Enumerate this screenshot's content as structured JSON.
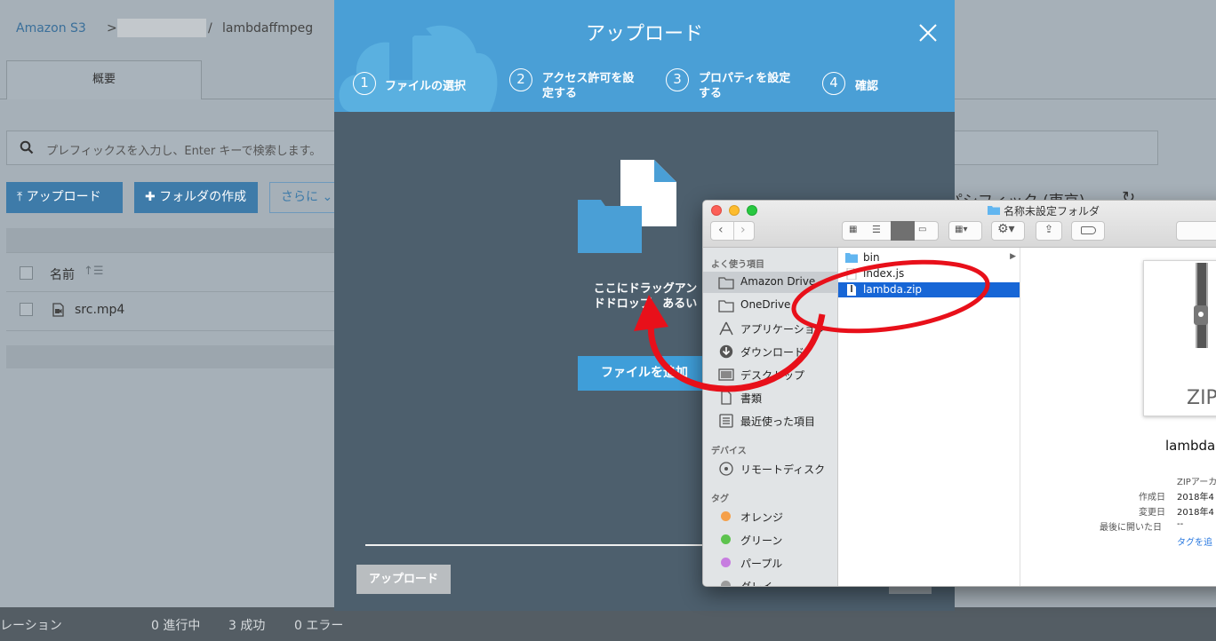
{
  "console": {
    "breadcrumb": {
      "root": "Amazon S3",
      "sep": ">",
      "sep2": "/",
      "current": "lambdaffmpeg"
    },
    "tab_overview": "概要",
    "search_placeholder": "プレフィックスを入力し、Enter キーで検索します。",
    "btn_upload": "アップロード",
    "btn_folder": "フォルダの作成",
    "btn_more": "さらに",
    "region": "パシフィック (東京)",
    "col_name": "名前",
    "files": [
      "src.mp4"
    ]
  },
  "status": {
    "label": "レーション",
    "in_progress": "0 進行中",
    "success": "3 成功",
    "errors": "0 エラー"
  },
  "modal": {
    "title": "アップロード",
    "steps": [
      {
        "num": "1",
        "label": "ファイルの選択"
      },
      {
        "num": "2",
        "label": "アクセス許可を設\n定する"
      },
      {
        "num": "3",
        "label": "プロパティを設定\nする"
      },
      {
        "num": "4",
        "label": "確認"
      }
    ],
    "drop_text": "ここにドラッグアン\nドドロップ、あるい\nは",
    "add_file": "ファイルを追加",
    "upload": "アップロード"
  },
  "finder": {
    "title": "名称未設定フォルダ",
    "sections": {
      "favorites": "よく使う項目",
      "devices": "デバイス",
      "tags": "タグ"
    },
    "favorites": [
      "Amazon Drive",
      "OneDrive",
      "アプリケーション",
      "ダウンロード",
      "デスクトップ",
      "書類",
      "最近使った項目"
    ],
    "devices": [
      "リモートディスク"
    ],
    "tags": [
      {
        "name": "オレンジ",
        "color": "#f5a04a"
      },
      {
        "name": "グリーン",
        "color": "#5dc34e"
      },
      {
        "name": "パープル",
        "color": "#c77de0"
      },
      {
        "name": "グレイ",
        "color": "#9b9b9b"
      }
    ],
    "files": [
      "bin",
      "index.js",
      "lambda.zip"
    ],
    "preview": {
      "thumb_label": "ZIP",
      "name": "lambda",
      "kind": "ZIPアーカ",
      "created_label": "作成日",
      "created": "2018年4",
      "modified_label": "変更日",
      "modified": "2018年4",
      "opened_label": "最後に開いた日",
      "opened": "--",
      "add_tag": "タグを追"
    }
  },
  "colors": {
    "accent": "#4a9fd6",
    "annotation": "#e8101a",
    "selection": "#1766d6"
  }
}
